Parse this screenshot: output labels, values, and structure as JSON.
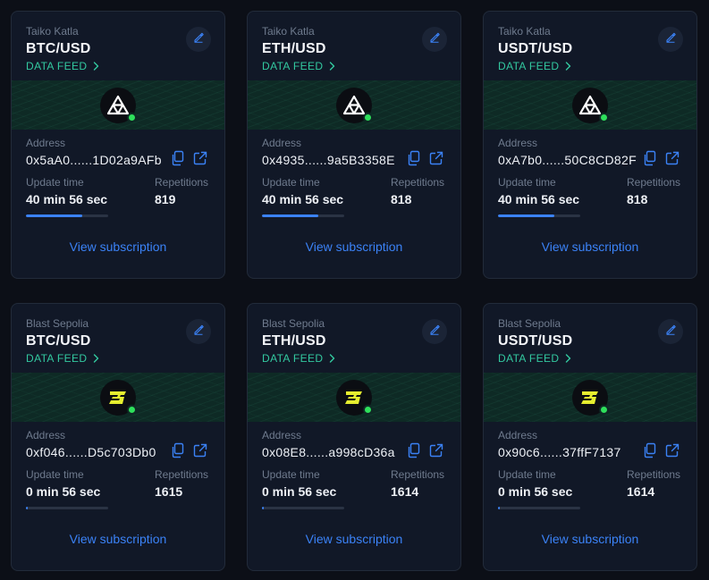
{
  "colors": {
    "background": "#0c0f17",
    "card": "#111827",
    "accent_blue": "#3b82f6",
    "feed_green": "#33c9a0",
    "status_green": "#2ee05b",
    "blast_yellow": "#e6ef2f"
  },
  "labels": {
    "data_feed": "DATA FEED",
    "address": "Address",
    "update_time": "Update time",
    "repetitions": "Repetitions",
    "view_subscription": "View subscription"
  },
  "cards": [
    {
      "network": "Taiko Katla",
      "pair": "BTC/USD",
      "logo": "taiko-logo-icon",
      "address": "0x5aA0......1D02a9AFb",
      "update_time": "40 min 56 sec",
      "repetitions": "819",
      "progress": 0.68
    },
    {
      "network": "Taiko Katla",
      "pair": "ETH/USD",
      "logo": "taiko-logo-icon",
      "address": "0x4935......9a5B3358E",
      "update_time": "40 min 56 sec",
      "repetitions": "818",
      "progress": 0.68
    },
    {
      "network": "Taiko Katla",
      "pair": "USDT/USD",
      "logo": "taiko-logo-icon",
      "address": "0xA7b0......50C8CD82F",
      "update_time": "40 min 56 sec",
      "repetitions": "818",
      "progress": 0.68
    },
    {
      "network": "Blast Sepolia",
      "pair": "BTC/USD",
      "logo": "blast-logo-icon",
      "address": "0xf046......D5c703Db0",
      "update_time": "0 min 56 sec",
      "repetitions": "1615",
      "progress": 0.02
    },
    {
      "network": "Blast Sepolia",
      "pair": "ETH/USD",
      "logo": "blast-logo-icon",
      "address": "0x08E8......a998cD36a",
      "update_time": "0 min 56 sec",
      "repetitions": "1614",
      "progress": 0.02
    },
    {
      "network": "Blast Sepolia",
      "pair": "USDT/USD",
      "logo": "blast-logo-icon",
      "address": "0x90c6......37ffF7137",
      "update_time": "0 min 56 sec",
      "repetitions": "1614",
      "progress": 0.02
    }
  ]
}
